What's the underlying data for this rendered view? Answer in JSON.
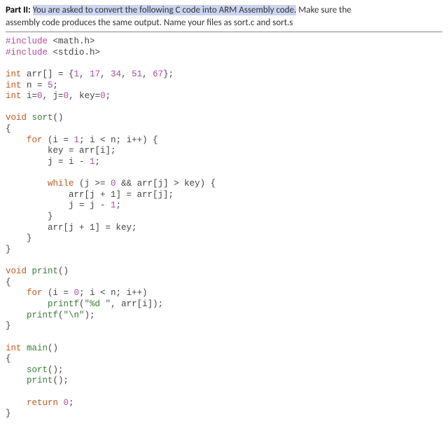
{
  "instruction": {
    "label": "Part II:",
    "highlighted": "You are asked to convert the following C code into ARM Assembly code.",
    "rest1": " Make sure the",
    "rest2": "assembly code produces the same output. Name your files as sort.c and sort.s"
  },
  "code": {
    "l01a": "#include",
    "l01b": " <math.h>",
    "l02a": "#include",
    "l02b": " <stdio.h>",
    "kw_int": "int",
    "kw_void": "void",
    "kw_for": "for",
    "kw_while": "while",
    "kw_return": "return",
    "arr_decl_a": " arr[] = {",
    "n1": "1",
    "sep": ", ",
    "n2": "17",
    "n3": "34",
    "n4": "51",
    "n5": "67",
    "arr_decl_b": "};",
    "n_decl_a": " n = ",
    "n_n": "5",
    "semi": ";",
    "ijk_a": " i=",
    "z": "0",
    "ijk_b": ", j=",
    "ijk_c": ", key=",
    "fn_sort": "sort",
    "fn_print": "print",
    "fn_printf": "printf",
    "fn_main": "main",
    "paren_empty": "()",
    "brace_o": "{",
    "brace_c": "}",
    "for_outer_a": " (i = ",
    "one": "1",
    "for_outer_b": "; i < n; i++) {",
    "key_assign": "key = arr[i];",
    "j_assign_a": "j = i - ",
    "while_a": " (j >= ",
    "while_b": " && arr[j] > key) {",
    "shift": "arr[j + 1] = arr[j];",
    "jdec_a": "j = j - ",
    "place": "arr[j + 1] = key;",
    "for_print_a": " (i = ",
    "for_print_b": "; i < n; i++)",
    "printf_call_a": "(",
    "str_fmt": "\"%d \"",
    "printf_call_b": ", arr[i]);",
    "str_nl": "\"\\n\"",
    "printf_nl_b": ");",
    "sort_call": "();",
    "print_call": "();",
    "ret_b": " ",
    "sp4": "    ",
    "sp8": "        ",
    "sp12": "            "
  }
}
